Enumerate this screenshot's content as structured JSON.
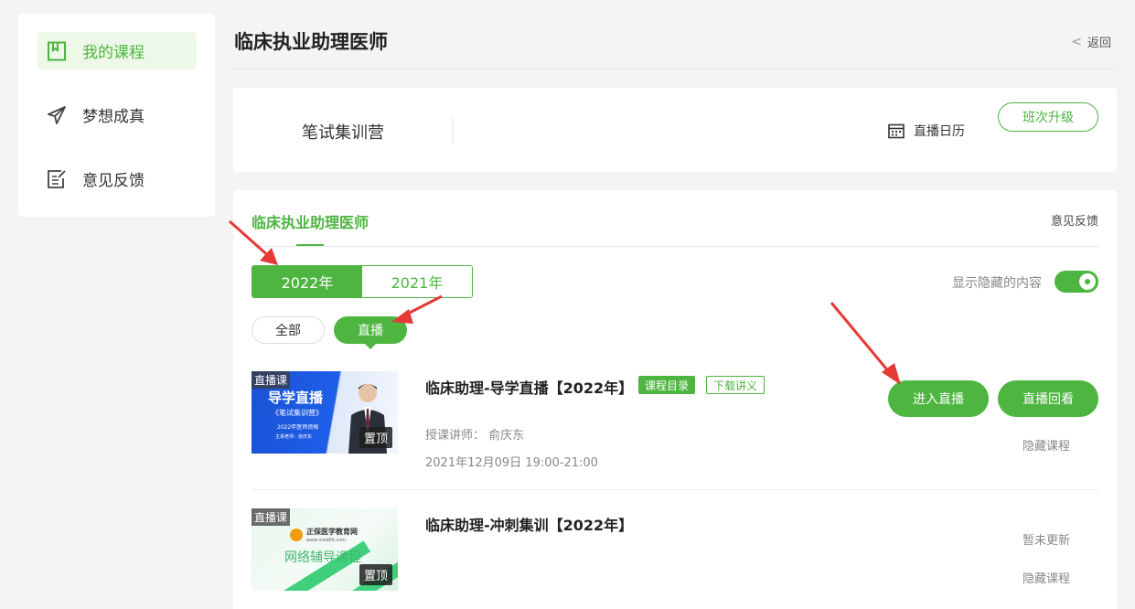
{
  "sidebar": {
    "items": [
      {
        "label": "我的课程",
        "icon": "bookmark-icon",
        "active": true
      },
      {
        "label": "梦想成真",
        "icon": "paper-plane-icon",
        "active": false
      },
      {
        "label": "意见反馈",
        "icon": "edit-note-icon",
        "active": false
      }
    ]
  },
  "header": {
    "title": "临床执业助理医师",
    "back_label": "返回"
  },
  "class_card": {
    "name": "笔试集训营",
    "calendar_label": "直播日历",
    "upgrade_label": "班次升级"
  },
  "panel": {
    "tab_label": "临床执业助理医师",
    "feedback_label": "意见反馈",
    "years": [
      "2022年",
      "2021年"
    ],
    "active_year": "2022年",
    "show_hidden_label": "显示隐藏的内容",
    "show_hidden_on": true,
    "filters": [
      "全部",
      "直播"
    ],
    "active_filter": "直播"
  },
  "courses": [
    {
      "thumb_tag": "直播课",
      "thumb_title": "导学直播",
      "thumb_sub1": "《笔试集训营》",
      "thumb_sub2": "2022年医师资格",
      "thumb_sub3": "主讲老师：俞庆东",
      "pin_label": "置顶",
      "title": "临床助理-导学直播【2022年】",
      "tag_catalog": "课程目录",
      "tag_download": "下载讲义",
      "teacher": "授课讲师： 俞庆东",
      "time": "2021年12月09日 19:00-21:00",
      "enter_label": "进入直播",
      "replay_label": "直播回看",
      "hide_label": "隐藏课程"
    },
    {
      "thumb_tag": "直播课",
      "thumb_brand": "正保医学教育网",
      "thumb_url": "www.med66.com",
      "thumb_title": "网络辅导课程",
      "pin_label": "置顶",
      "title": "临床助理-冲刺集训【2022年】",
      "status_label": "暂未更新",
      "hide_label": "隐藏课程"
    }
  ],
  "colors": {
    "brand_green": "#4db540",
    "arrow_red": "#e53935"
  }
}
